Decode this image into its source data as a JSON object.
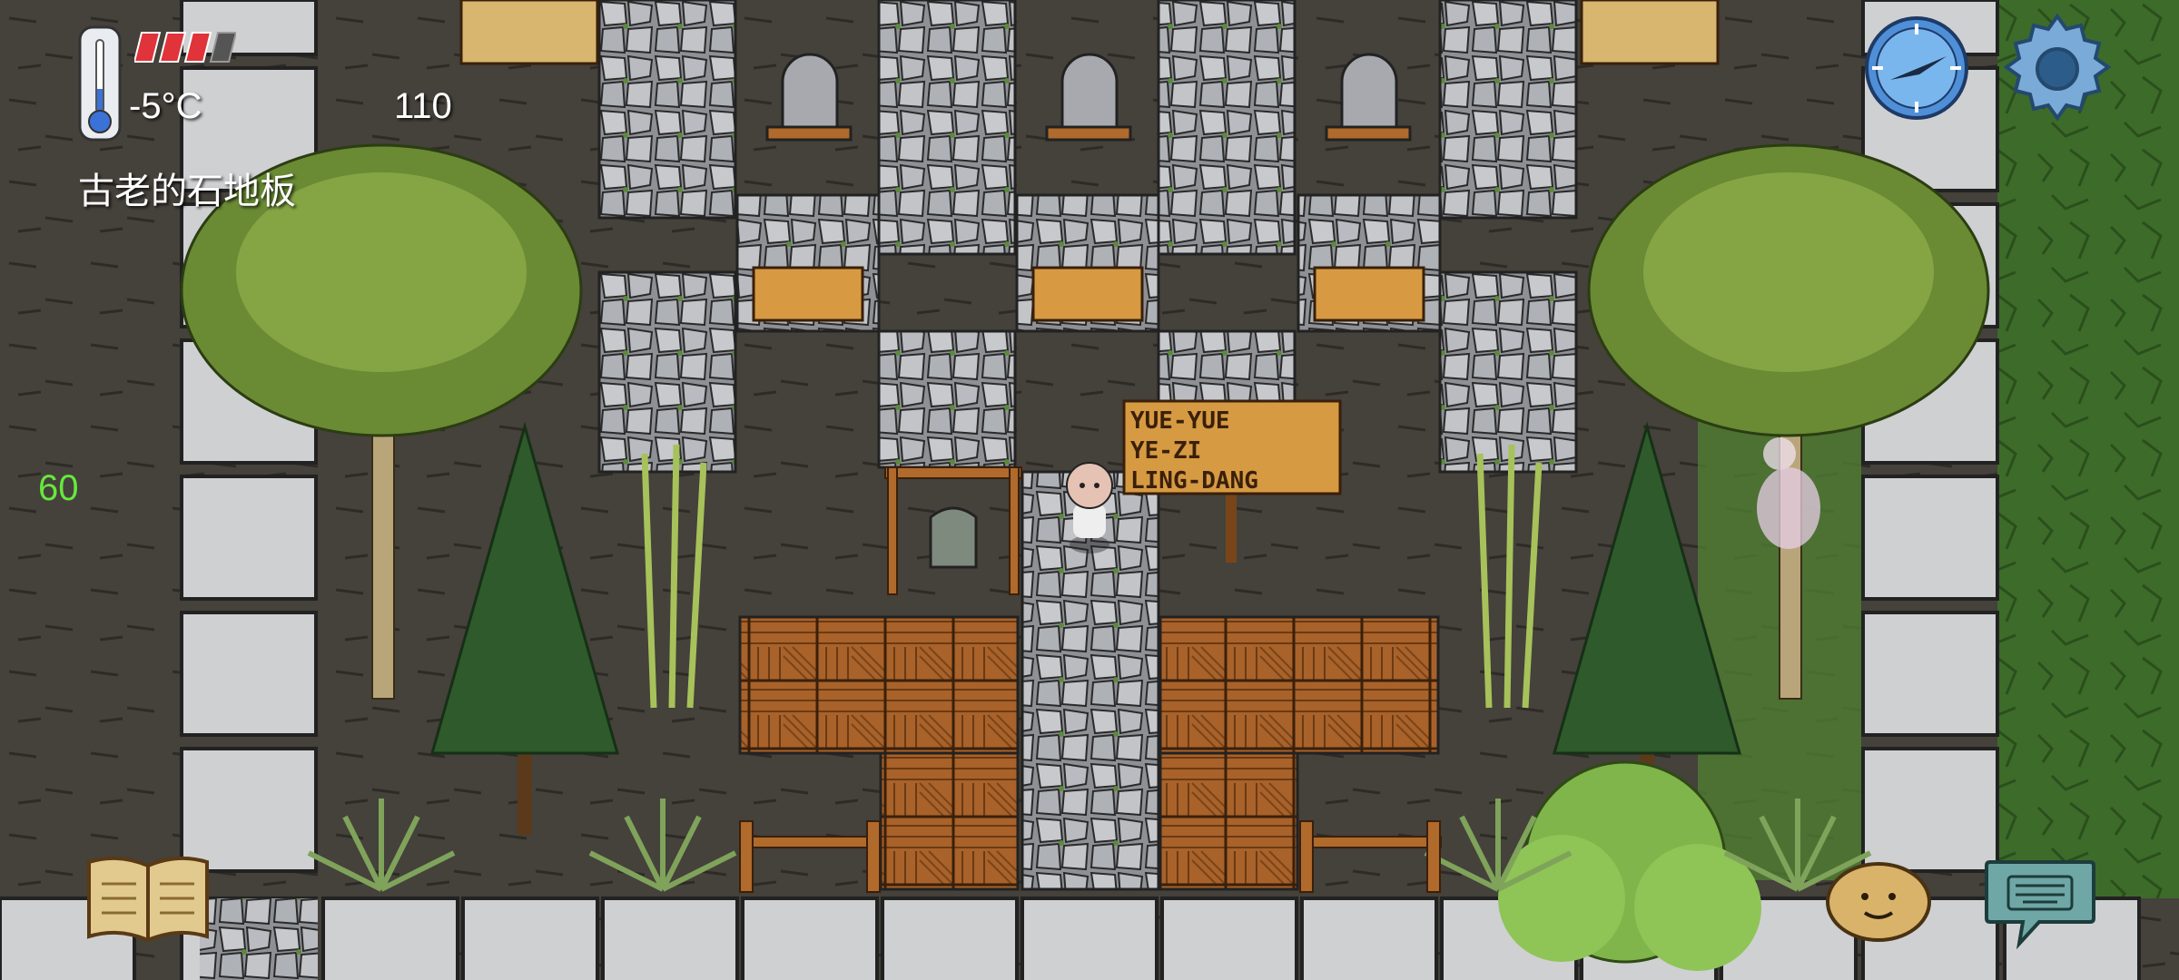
{
  "hud": {
    "temperature": "-5°C",
    "score": "110",
    "tile_name": "古老的石地板",
    "fps": "60",
    "health_bars_filled": 3,
    "health_bars_total": 4
  },
  "sign": {
    "line1": "YUE-YUE",
    "line2": "YE-ZI",
    "line3": "LING-DANG"
  },
  "icons": {
    "thermometer": "thermometer-icon",
    "compass": "compass-icon",
    "settings": "gear-icon",
    "journal": "book-icon",
    "emote": "potato-face-icon",
    "keyboard": "keyboard-icon"
  },
  "colors": {
    "grass": "#3d6b2a",
    "stone_path": "#b9bcc2",
    "floor": "#3f3b36",
    "wood": "#b06a2c",
    "health": "#e0333a",
    "fps": "#66e83d"
  }
}
